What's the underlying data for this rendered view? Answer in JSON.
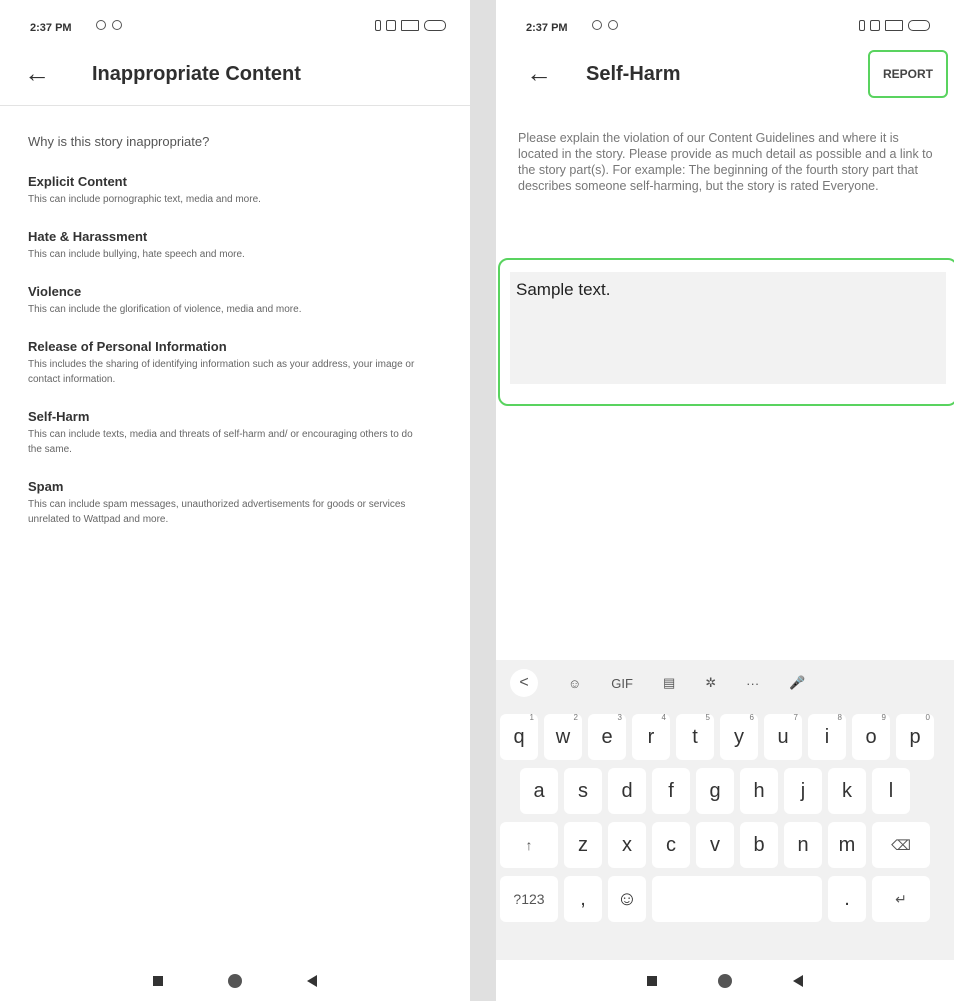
{
  "left": {
    "status_time": "2:37 PM",
    "title": "Inappropriate Content",
    "question": "Why is this story inappropriate?",
    "options": [
      {
        "title": "Explicit Content",
        "desc": "This can include pornographic text, media and more."
      },
      {
        "title": "Hate & Harassment",
        "desc": "This can include bullying, hate speech and more."
      },
      {
        "title": "Violence",
        "desc": "This can include the glorification of violence, media and more."
      },
      {
        "title": "Release of Personal Information",
        "desc": "This includes the sharing of identifying information such as your address, your image or contact information."
      },
      {
        "title": "Self-Harm",
        "desc": "This can include texts, media and threats of self-harm and/ or encouraging others to do the same."
      },
      {
        "title": "Spam",
        "desc": "This can include spam messages, unauthorized advertisements for goods or services unrelated to Wattpad and more."
      }
    ]
  },
  "right": {
    "status_time": "2:37 PM",
    "title": "Self-Harm",
    "report_label": "REPORT",
    "instructions": "Please explain the violation of our Content Guidelines and where it is located in the story. Please provide as much detail as possible and a link to the story part(s). For example: The beginning of the fourth story part that describes someone self-harming, but the story is rated Everyone.",
    "input_value": "Sample text.",
    "keyboard": {
      "toolbar": [
        "<",
        "☺",
        "GIF",
        "▤",
        "✲",
        "···",
        "🎤"
      ],
      "row1": [
        {
          "k": "q",
          "n": "1"
        },
        {
          "k": "w",
          "n": "2"
        },
        {
          "k": "e",
          "n": "3"
        },
        {
          "k": "r",
          "n": "4"
        },
        {
          "k": "t",
          "n": "5"
        },
        {
          "k": "y",
          "n": "6"
        },
        {
          "k": "u",
          "n": "7"
        },
        {
          "k": "i",
          "n": "8"
        },
        {
          "k": "o",
          "n": "9"
        },
        {
          "k": "p",
          "n": "0"
        }
      ],
      "row2": [
        "a",
        "s",
        "d",
        "f",
        "g",
        "h",
        "j",
        "k",
        "l"
      ],
      "row3": [
        "↑",
        "z",
        "x",
        "c",
        "v",
        "b",
        "n",
        "m",
        "⌫"
      ],
      "row4": [
        "?123",
        ",",
        "☺",
        "",
        ".",
        "↵"
      ]
    }
  }
}
